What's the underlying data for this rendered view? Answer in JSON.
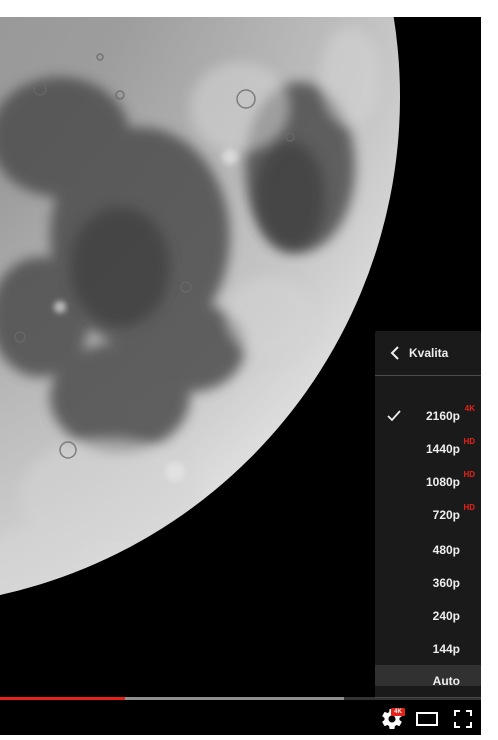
{
  "quality_menu": {
    "title": "Kvalita",
    "items": [
      {
        "label": "2160p",
        "badge": "4K",
        "selected": true
      },
      {
        "label": "1440p",
        "badge": "HD",
        "selected": false
      },
      {
        "label": "1080p",
        "badge": "HD",
        "selected": false
      },
      {
        "label": "720p",
        "badge": "HD",
        "selected": false
      },
      {
        "label": "480p",
        "badge": "",
        "selected": false
      },
      {
        "label": "360p",
        "badge": "",
        "selected": false
      },
      {
        "label": "240p",
        "badge": "",
        "selected": false
      },
      {
        "label": "144p",
        "badge": "",
        "selected": false
      },
      {
        "label": "Auto",
        "badge": "",
        "selected": false,
        "highlighted": true
      }
    ]
  },
  "progress": {
    "played_fraction": 0.26,
    "buffered_fraction": 0.715
  },
  "controls": {
    "settings_badge": "4K",
    "settings_icon": "gear-icon",
    "theater_icon": "theater-mode-icon",
    "fullscreen_icon": "fullscreen-icon"
  },
  "colors": {
    "accent": "#e62117",
    "menu_bg": "#1c1c1c"
  }
}
